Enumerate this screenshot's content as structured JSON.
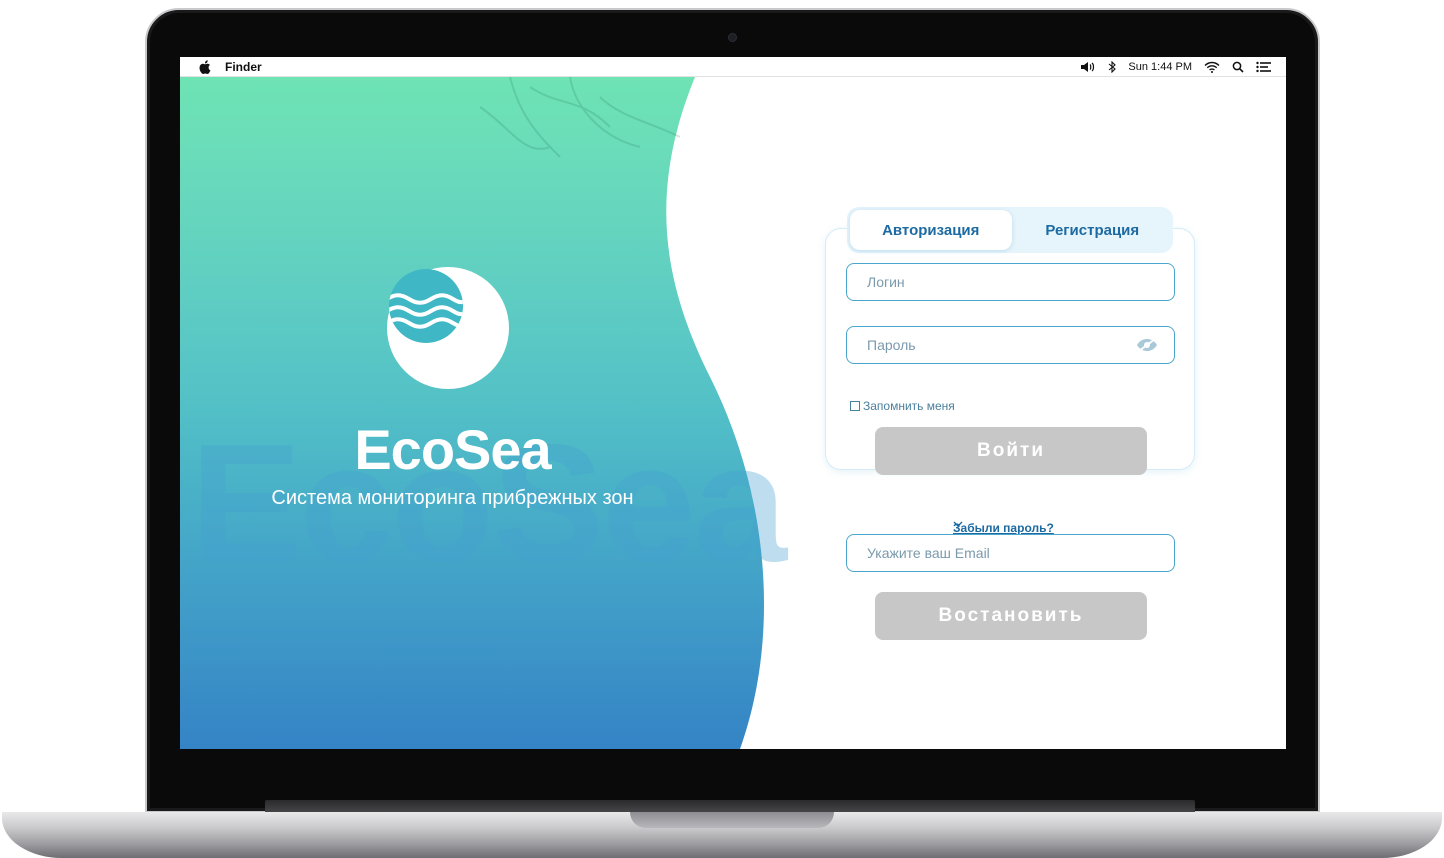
{
  "menubar": {
    "app_name": "Finder",
    "clock": "Sun 1:44 PM"
  },
  "brand": {
    "title": "EcoSea",
    "subtitle": "Система мониторинга прибрежных зон",
    "watermark": "EcoSea",
    "logo_icon": "sea-waves-icon"
  },
  "auth": {
    "tabs": [
      {
        "label": "Авторизация",
        "active": true
      },
      {
        "label": "Регистрация",
        "active": false
      }
    ],
    "login_placeholder": "Логин",
    "password_placeholder": "Пароль",
    "remember_label": "Запомнить меня",
    "submit_label": "Войти",
    "forgot_label": "Забыли пароль?",
    "email_placeholder": "Укажите ваш Email",
    "restore_label": "Востановить"
  },
  "colors": {
    "gradient_top": "#6ee3b4",
    "gradient_bottom": "#3a8fd6",
    "accent": "#1d6aa2",
    "field_border": "#4aa6cc",
    "button_disabled": "#c7c7c7"
  }
}
